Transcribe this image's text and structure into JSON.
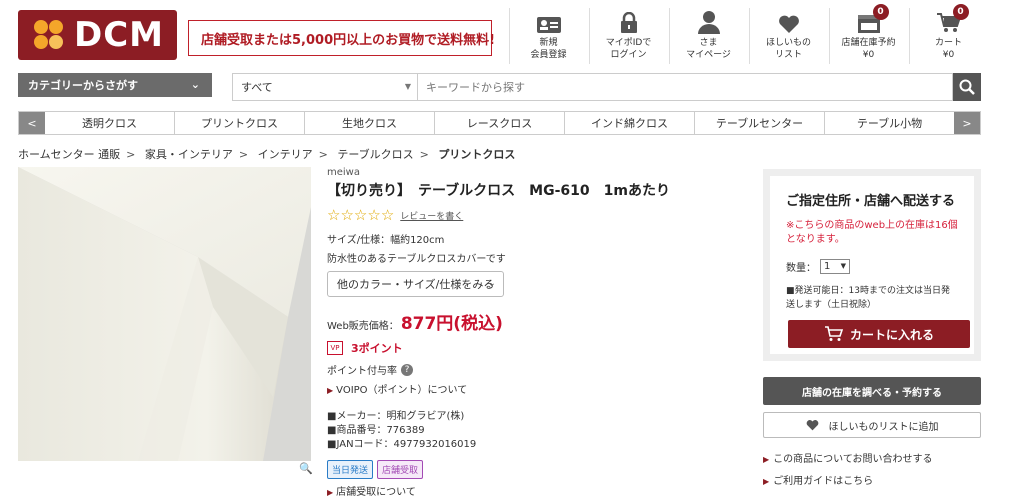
{
  "header": {
    "logo_text": "DCM",
    "promo_text": "店舗受取または5,000円以上のお買物で送料無料!",
    "nav": [
      {
        "line1": "新規",
        "line2": "会員登録",
        "icon": "member-card-icon"
      },
      {
        "line1": "マイポIDで",
        "line2": "ログイン",
        "icon": "lock-icon"
      },
      {
        "line1": "さま",
        "line2": "マイページ",
        "icon": "person-icon"
      },
      {
        "line1": "ほしいもの",
        "line2": "リスト",
        "icon": "heart-icon"
      },
      {
        "line1": "店舗在庫予約",
        "line2": "¥0",
        "icon": "store-reserve-icon",
        "badge": "0"
      },
      {
        "line1": "カート",
        "line2": "¥0",
        "icon": "cart-icon",
        "badge": "0"
      }
    ]
  },
  "search": {
    "category_button": "カテゴリーからさがす",
    "scope": "すべて",
    "placeholder": "キーワードから探す"
  },
  "category_nav": [
    "透明クロス",
    "プリントクロス",
    "生地クロス",
    "レースクロス",
    "インド綿クロス",
    "テーブルセンター",
    "テーブル小物"
  ],
  "breadcrumb": [
    "ホームセンター 通販",
    "家具・インテリア",
    "インテリア",
    "テーブルクロス",
    "プリントクロス"
  ],
  "product": {
    "brand": "meiwa",
    "title": "【切り売り】　テーブルクロス　MG-610　1mあたり",
    "review_link": "レビューを書く",
    "size": "サイズ/仕様：幅約120cm",
    "description": "防水性のあるテーブルクロスカバーです",
    "variant_button": "他のカラー・サイズ/仕様をみる",
    "price_label": "Web販売価格：",
    "price": "877円(税込)",
    "points_icon": "VP",
    "points": "3ポイント",
    "point_rate_label": "ポイント付与率",
    "voipo_link": "VOIPO（ポイント）について",
    "maker": "■メーカー：明和グラビア(株)",
    "item_no": "■商品番号：776389",
    "jan": "■JANコード：4977932016019",
    "tags": [
      "当日発送",
      "店舗受取"
    ],
    "store_pickup_link": "店舗受取について"
  },
  "delivery": {
    "title": "ご指定住所・店舗へ配送する",
    "stock_note": "※こちらの商品のweb上の在庫は16個となります。",
    "qty_label": "数量：",
    "qty_value": "1",
    "ship_note": "■発送可能日：13時までの注文は当日発送します（土日祝除）",
    "cart_button": "カートに入れる"
  },
  "actions": {
    "stock_button": "店舗の在庫を調べる・予約する",
    "wish_button": "ほしいものリストに追加",
    "inquiry_link": "この商品についてお問い合わせする",
    "guide_link": "ご利用ガイドはこちら"
  }
}
